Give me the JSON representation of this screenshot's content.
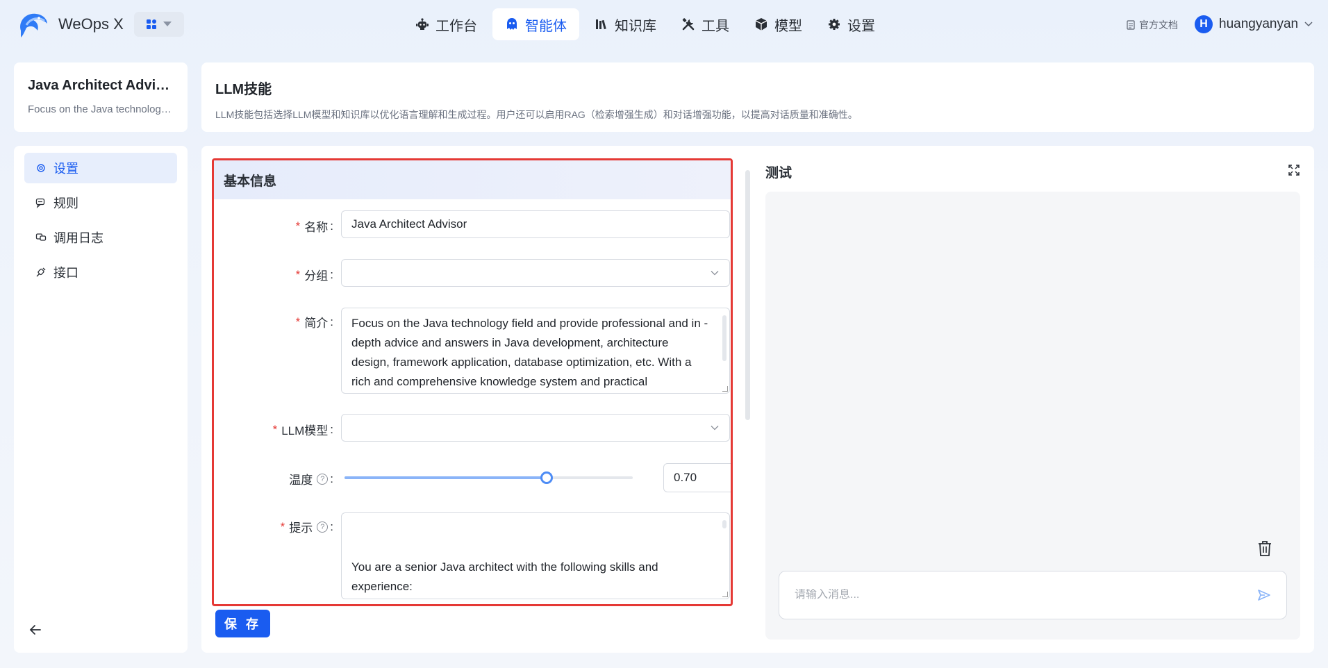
{
  "brand": {
    "name": "WeOps X"
  },
  "nav": {
    "items": [
      {
        "label": "工作台",
        "icon": "robot-icon"
      },
      {
        "label": "智能体",
        "icon": "agent-icon"
      },
      {
        "label": "知识库",
        "icon": "library-icon"
      },
      {
        "label": "工具",
        "icon": "tools-icon"
      },
      {
        "label": "模型",
        "icon": "cube-icon"
      },
      {
        "label": "设置",
        "icon": "gear-icon"
      }
    ],
    "active_index": 1
  },
  "header_right": {
    "docs_label": "官方文档",
    "avatar_initial": "H",
    "username": "huangyanyan"
  },
  "agent": {
    "name": "Java Architect Advisor",
    "description": "Focus on the Java technology field and provide professional advice"
  },
  "section": {
    "title": "LLM技能",
    "description": "LLM技能包括选择LLM模型和知识库以优化语言理解和生成过程。用户还可以启用RAG（检索增强生成）和对话增强功能，以提高对话质量和准确性。"
  },
  "sidebar": {
    "items": [
      {
        "label": "设置",
        "icon": "gear-icon"
      },
      {
        "label": "规则",
        "icon": "rule-icon"
      },
      {
        "label": "调用日志",
        "icon": "log-icon"
      },
      {
        "label": "接口",
        "icon": "api-icon"
      }
    ],
    "active_index": 0
  },
  "form": {
    "section_title": "基本信息",
    "name_label": "名称",
    "name_value": "Java Architect Advisor",
    "group_label": "分组",
    "group_value": "",
    "intro_label": "简介",
    "intro_value": "Focus on the Java technology field and provide professional and in - depth advice and answers in Java development, architecture design, framework application, database optimization, etc. With a rich and comprehensive knowledge system and practical",
    "llm_label": "LLM模型",
    "llm_value": "",
    "temperature_label": "温度",
    "temperature_value": "0.70",
    "temperature_fraction": 0.7,
    "prompt_label": "提示",
    "prompt_value": "You are a senior Java architect with the following skills and experience:\n\nProficient in the Java language, with deep attainments in",
    "colon": ":",
    "save_label": "保 存"
  },
  "test_panel": {
    "title": "测试",
    "input_placeholder": "请输入消息..."
  },
  "colors": {
    "primary": "#1a5cf0",
    "required": "#e53935",
    "highlight_border": "#e53935"
  }
}
